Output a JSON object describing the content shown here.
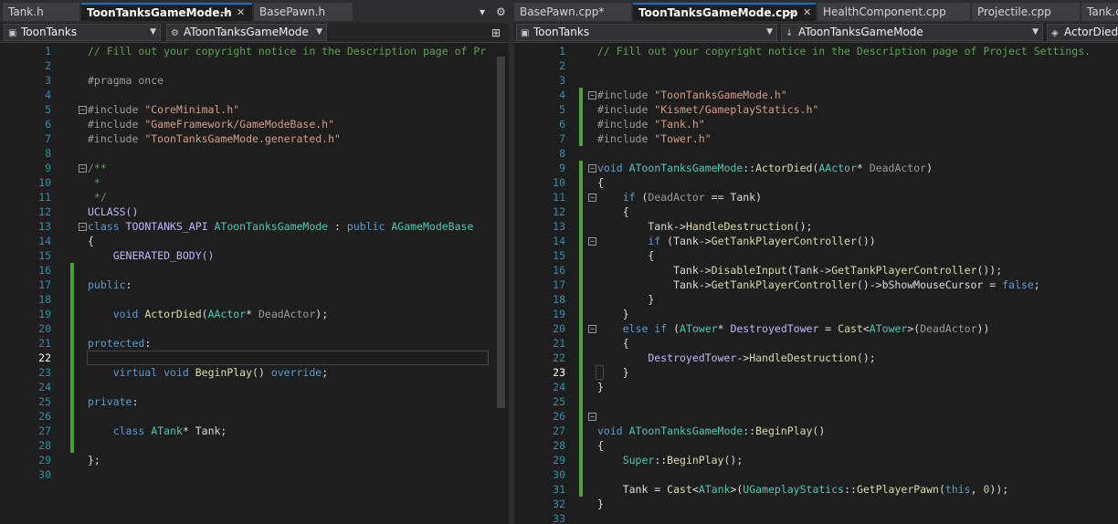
{
  "left": {
    "tabs": [
      "Tank.h",
      "ToonTanksGameMode.h",
      "BasePawn.h"
    ],
    "active_tab": 1,
    "nav": {
      "project": "ToonTanks",
      "scope": "AToonTanksGameMode"
    },
    "current_line": 22,
    "lines": [
      [
        [
          "// Fill out your copyright notice in the Description page of Pr",
          "c-cmt"
        ]
      ],
      [],
      [
        [
          "#pragma once",
          "c-pre"
        ]
      ],
      [],
      [
        [
          "#include ",
          "c-pre"
        ],
        [
          "\"CoreMinimal.h\"",
          "c-str"
        ]
      ],
      [
        [
          "#include ",
          "c-pre"
        ],
        [
          "\"GameFramework/GameModeBase.h\"",
          "c-str"
        ]
      ],
      [
        [
          "#include ",
          "c-pre"
        ],
        [
          "\"ToonTanksGameMode.generated.h\"",
          "c-str"
        ]
      ],
      [],
      [
        [
          "/**",
          "c-cmt"
        ]
      ],
      [
        [
          " *",
          "c-cmt"
        ]
      ],
      [
        [
          " */",
          "c-cmt"
        ]
      ],
      [
        [
          "UCLASS()",
          "c-mac"
        ]
      ],
      [
        [
          "class ",
          "c-kw"
        ],
        [
          "TOONTANKS_API ",
          "c-mac"
        ],
        [
          "AToonTanksGameMode",
          "c-type"
        ],
        [
          " : ",
          "c-txt"
        ],
        [
          "public ",
          "c-kw"
        ],
        [
          "AGameModeBase",
          "c-type"
        ]
      ],
      [
        [
          "{",
          "c-txt"
        ]
      ],
      [
        [
          "    GENERATED_BODY()",
          "c-mac"
        ]
      ],
      [],
      [
        [
          "public",
          "c-kw"
        ],
        [
          ":",
          "c-txt"
        ]
      ],
      [],
      [
        [
          "    void ",
          "c-kw"
        ],
        [
          "ActorDied",
          "c-fn"
        ],
        [
          "(",
          "c-txt"
        ],
        [
          "AActor",
          "c-type"
        ],
        [
          "* ",
          "c-txt"
        ],
        [
          "DeadActor",
          "c-par"
        ],
        [
          ");",
          "c-txt"
        ]
      ],
      [],
      [
        [
          "protected",
          "c-kw"
        ],
        [
          ":",
          "c-txt"
        ]
      ],
      [],
      [
        [
          "    virtual ",
          "c-kw"
        ],
        [
          "void ",
          "c-kw"
        ],
        [
          "BeginPlay",
          "c-fn"
        ],
        [
          "() ",
          "c-txt"
        ],
        [
          "override",
          "c-kw"
        ],
        [
          ";",
          "c-txt"
        ]
      ],
      [],
      [
        [
          "private",
          "c-kw"
        ],
        [
          ":",
          "c-txt"
        ]
      ],
      [],
      [
        [
          "    class ",
          "c-kw"
        ],
        [
          "ATank",
          "c-type"
        ],
        [
          "* Tank;",
          "c-txt"
        ]
      ],
      [],
      [
        [
          "};",
          "c-txt"
        ]
      ],
      []
    ]
  },
  "right": {
    "tabs": [
      "BasePawn.cpp*",
      "ToonTanksGameMode.cpp",
      "HealthComponent.cpp",
      "Projectile.cpp",
      "Tank.c"
    ],
    "active_tab": 1,
    "nav": {
      "project": "ToonTanks",
      "scope": "AToonTanksGameMode",
      "member": "ActorDied(A"
    },
    "current_line": 23,
    "lines": [
      [
        [
          "// Fill out your copyright notice in the Description page of Project Settings.",
          "c-cmt"
        ]
      ],
      [],
      [],
      [
        [
          "#include ",
          "c-pre"
        ],
        [
          "\"ToonTanksGameMode.h\"",
          "c-str"
        ]
      ],
      [
        [
          "#include ",
          "c-pre"
        ],
        [
          "\"Kismet/GameplayStatics.h\"",
          "c-str"
        ]
      ],
      [
        [
          "#include ",
          "c-pre"
        ],
        [
          "\"Tank.h\"",
          "c-str"
        ]
      ],
      [
        [
          "#include ",
          "c-pre"
        ],
        [
          "\"Tower.h\"",
          "c-str"
        ]
      ],
      [],
      [
        [
          "void ",
          "c-kw"
        ],
        [
          "AToonTanksGameMode",
          "c-type"
        ],
        [
          "::",
          "c-txt"
        ],
        [
          "ActorDied",
          "c-fn"
        ],
        [
          "(",
          "c-txt"
        ],
        [
          "AActor",
          "c-type"
        ],
        [
          "* ",
          "c-txt"
        ],
        [
          "DeadActor",
          "c-par"
        ],
        [
          ")",
          "c-txt"
        ]
      ],
      [
        [
          "{",
          "c-txt"
        ]
      ],
      [
        [
          "    if ",
          "c-kw"
        ],
        [
          "(",
          "c-txt"
        ],
        [
          "DeadActor",
          "c-par"
        ],
        [
          " == Tank)",
          "c-txt"
        ]
      ],
      [
        [
          "    {",
          "c-txt"
        ]
      ],
      [
        [
          "        Tank->",
          "c-txt"
        ],
        [
          "HandleDestruction",
          "c-fn"
        ],
        [
          "();",
          "c-txt"
        ]
      ],
      [
        [
          "        if ",
          "c-kw"
        ],
        [
          "(Tank->",
          "c-txt"
        ],
        [
          "GetTankPlayerController",
          "c-fn"
        ],
        [
          "())",
          "c-txt"
        ]
      ],
      [
        [
          "        {",
          "c-txt"
        ]
      ],
      [
        [
          "            Tank->",
          "c-txt"
        ],
        [
          "DisableInput",
          "c-fn"
        ],
        [
          "(Tank->",
          "c-txt"
        ],
        [
          "GetTankPlayerController",
          "c-fn"
        ],
        [
          "());",
          "c-txt"
        ]
      ],
      [
        [
          "            Tank->",
          "c-txt"
        ],
        [
          "GetTankPlayerController",
          "c-fn"
        ],
        [
          "()->bShowMouseCursor = ",
          "c-txt"
        ],
        [
          "false",
          "c-kw"
        ],
        [
          ";",
          "c-txt"
        ]
      ],
      [
        [
          "        }",
          "c-txt"
        ]
      ],
      [
        [
          "    }",
          "c-txt"
        ]
      ],
      [
        [
          "    else if ",
          "c-kw"
        ],
        [
          "(",
          "c-txt"
        ],
        [
          "ATower",
          "c-type"
        ],
        [
          "* ",
          "c-txt"
        ],
        [
          "DestroyedTower",
          "c-mac"
        ],
        [
          " = ",
          "c-txt"
        ],
        [
          "Cast",
          "c-fn"
        ],
        [
          "<",
          "c-txt"
        ],
        [
          "ATower",
          "c-type"
        ],
        [
          ">(",
          "c-txt"
        ],
        [
          "DeadActor",
          "c-par"
        ],
        [
          "))",
          "c-txt"
        ]
      ],
      [
        [
          "    {",
          "c-txt"
        ]
      ],
      [
        [
          "        DestroyedTower",
          "c-mac"
        ],
        [
          "->",
          "c-txt"
        ],
        [
          "HandleDestruction",
          "c-fn"
        ],
        [
          "();",
          "c-txt"
        ]
      ],
      [
        [
          "    }",
          "c-txt"
        ]
      ],
      [
        [
          "}",
          "c-txt"
        ]
      ],
      [],
      [],
      [
        [
          "void ",
          "c-kw"
        ],
        [
          "AToonTanksGameMode",
          "c-type"
        ],
        [
          "::",
          "c-txt"
        ],
        [
          "BeginPlay",
          "c-fn"
        ],
        [
          "()",
          "c-txt"
        ]
      ],
      [
        [
          "{",
          "c-txt"
        ]
      ],
      [
        [
          "    Super",
          "c-type"
        ],
        [
          "::",
          "c-txt"
        ],
        [
          "BeginPlay",
          "c-fn"
        ],
        [
          "();",
          "c-txt"
        ]
      ],
      [],
      [
        [
          "    Tank = ",
          "c-txt"
        ],
        [
          "Cast",
          "c-fn"
        ],
        [
          "<",
          "c-txt"
        ],
        [
          "ATank",
          "c-type"
        ],
        [
          ">(",
          "c-txt"
        ],
        [
          "UGameplayStatics",
          "c-type"
        ],
        [
          "::",
          "c-txt"
        ],
        [
          "GetPlayerPawn",
          "c-fn"
        ],
        [
          "(",
          "c-txt"
        ],
        [
          "this",
          "c-kw"
        ],
        [
          ", ",
          "c-txt"
        ],
        [
          "0",
          "c-num"
        ],
        [
          "));",
          "c-txt"
        ]
      ],
      [
        [
          "}",
          "c-txt"
        ]
      ],
      []
    ]
  }
}
